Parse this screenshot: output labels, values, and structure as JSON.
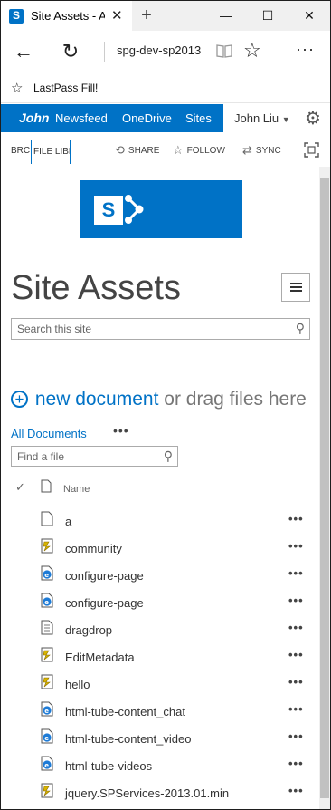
{
  "browser": {
    "tab_title": "Site Assets - A",
    "new_tab": "+",
    "url": "spg-dev-sp2013",
    "favorites": [
      {
        "label": "LastPass Fill!"
      }
    ],
    "window_controls": {
      "minimize": "—",
      "maximize": "☐",
      "close": "✕"
    }
  },
  "suite": {
    "brand": "John",
    "links": [
      "Newsfeed",
      "OneDrive",
      "Sites"
    ],
    "user": "John Liu"
  },
  "ribbon": {
    "tabs": [
      "BRC",
      "FILE",
      "LIBR"
    ],
    "actions": [
      {
        "label": "SHARE",
        "icon": "share-icon"
      },
      {
        "label": "FOLLOW",
        "icon": "star-icon"
      },
      {
        "label": "SYNC",
        "icon": "sync-icon"
      }
    ]
  },
  "page": {
    "title": "Site Assets",
    "site_search_placeholder": "Search this site",
    "new_document": "new document",
    "drag_text": "or drag files here",
    "view_name": "All Documents",
    "view_more": "•••",
    "find_file_placeholder": "Find a file",
    "column_name": "Name"
  },
  "files": [
    {
      "name": "a",
      "icon": "blank-file-icon"
    },
    {
      "name": "community",
      "icon": "js-file-icon"
    },
    {
      "name": "configure-page",
      "icon": "html-file-icon"
    },
    {
      "name": "configure-page",
      "icon": "html-file-icon"
    },
    {
      "name": "dragdrop",
      "icon": "text-file-icon"
    },
    {
      "name": "EditMetadata",
      "icon": "js-file-icon"
    },
    {
      "name": "hello",
      "icon": "js-file-icon"
    },
    {
      "name": "html-tube-content_chat",
      "icon": "html-file-icon"
    },
    {
      "name": "html-tube-content_video",
      "icon": "html-file-icon"
    },
    {
      "name": "html-tube-videos",
      "icon": "html-file-icon"
    },
    {
      "name": "jquery.SPServices-2013.01.min",
      "icon": "js-file-icon"
    }
  ],
  "colors": {
    "brand_blue": "#0072c6"
  }
}
